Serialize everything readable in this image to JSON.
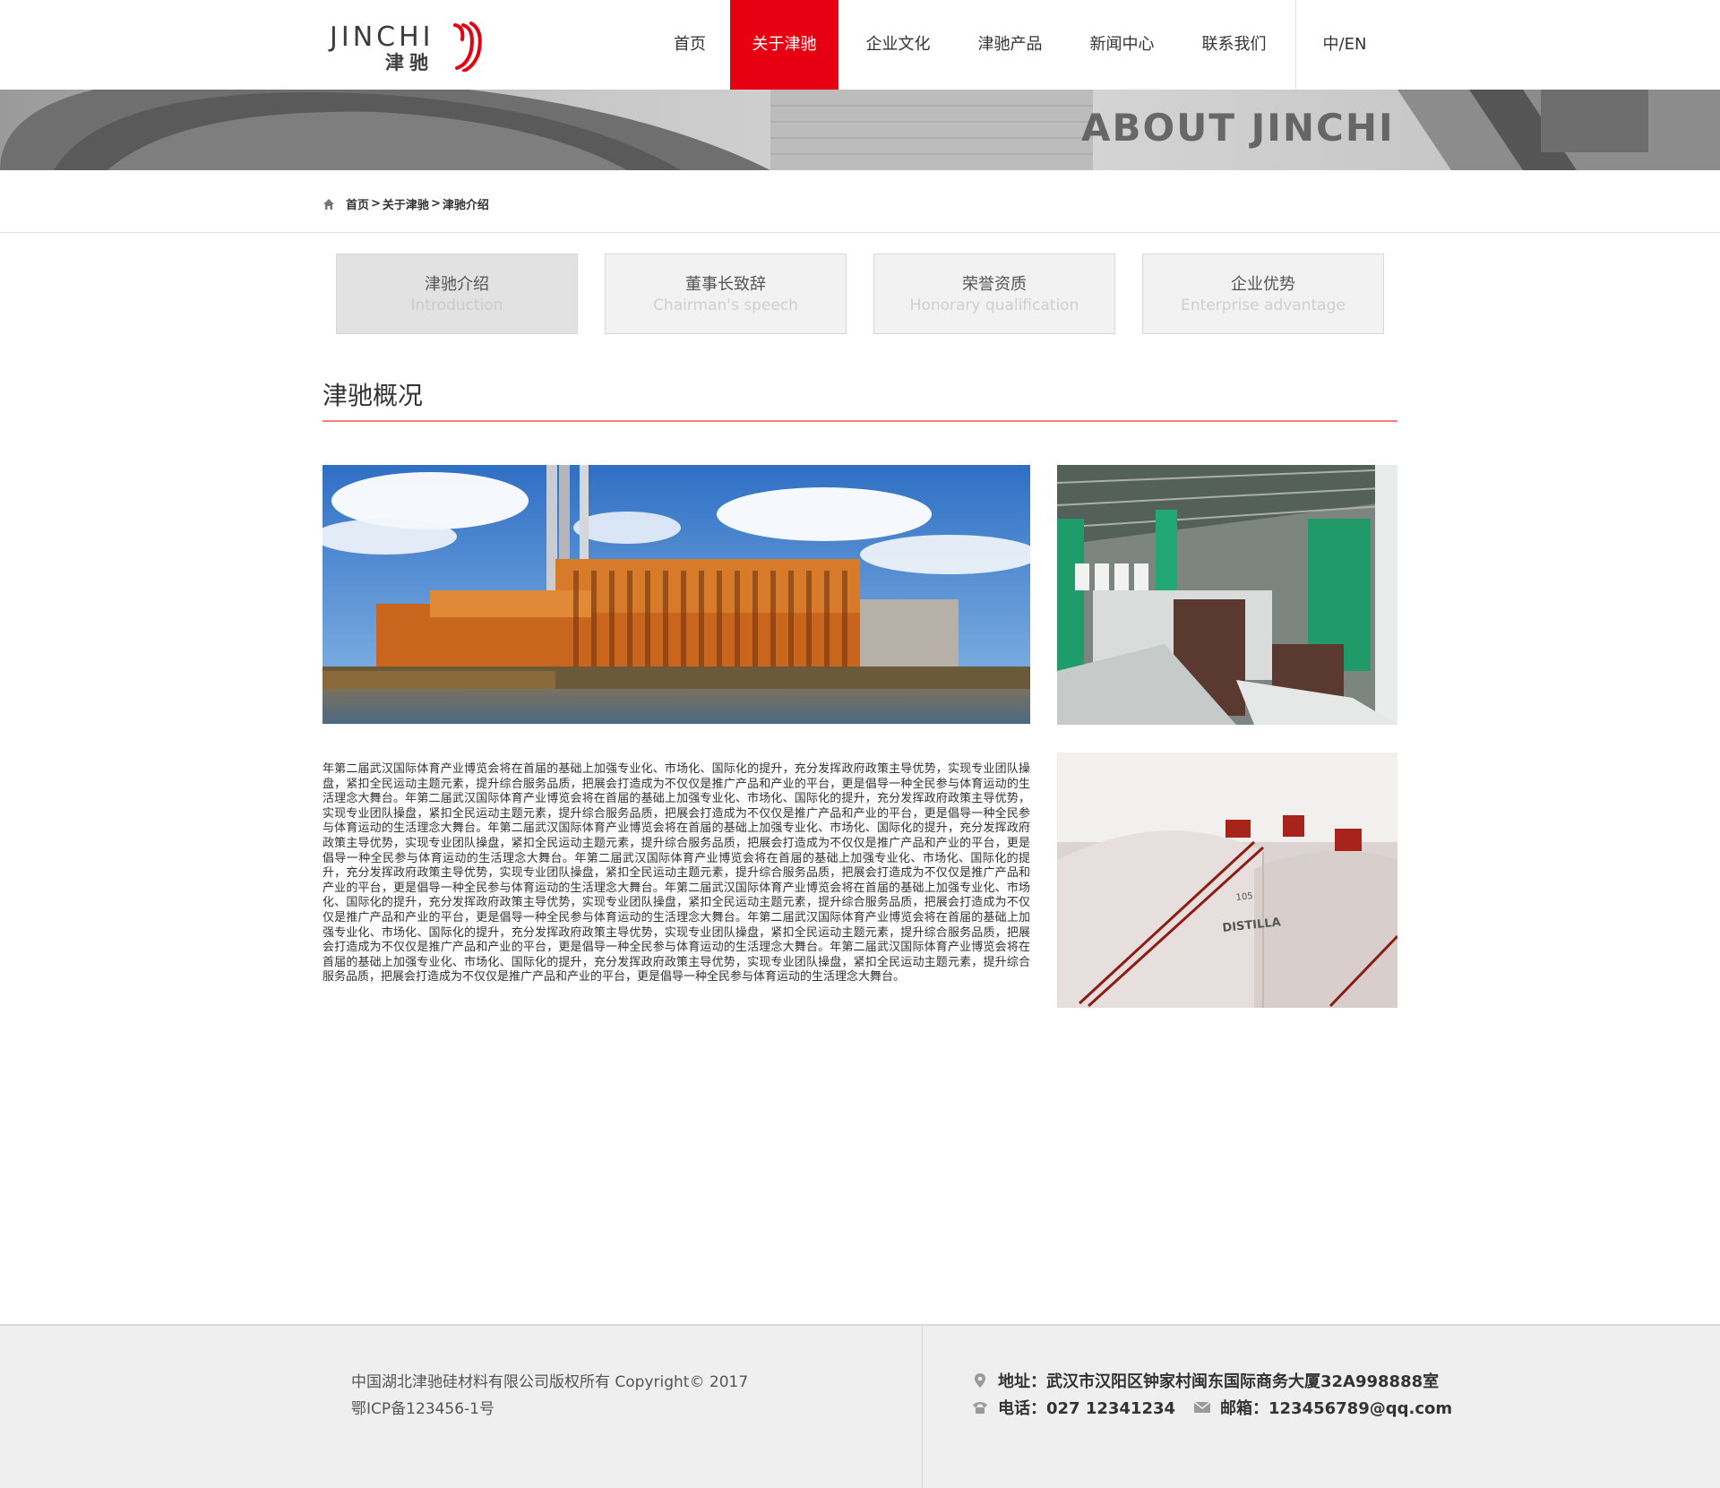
{
  "header": {
    "logo_en": "JINCHI",
    "logo_cn": "津驰",
    "nav": [
      {
        "label": "首页"
      },
      {
        "label": "关于津驰"
      },
      {
        "label": "企业文化"
      },
      {
        "label": "津驰产品"
      },
      {
        "label": "新闻中心"
      },
      {
        "label": "联系我们"
      }
    ],
    "active_nav": "关于津驰",
    "lang": "中/EN"
  },
  "banner": {
    "title": "ABOUT JINCHI"
  },
  "breadcrumb": {
    "items": [
      "首页",
      "关于津驰",
      "津驰介绍"
    ],
    "separator": ">"
  },
  "tabs": [
    {
      "cn": "津驰介绍",
      "en": "Introduction",
      "active": true
    },
    {
      "cn": "董事长致辞",
      "en": "Chairman's speech",
      "active": false
    },
    {
      "cn": "荣誉资质",
      "en": "Honorary qualification",
      "active": false
    },
    {
      "cn": "企业优势",
      "en": "Enterprise advantage",
      "active": false
    }
  ],
  "section": {
    "title": "津驰概况",
    "body": "年第二届武汉国际体育产业博览会将在首届的基础上加强专业化、市场化、国际化的提升，充分发挥政府政策主导优势，实现专业团队操盘，紧扣全民运动主题元素，提升综合服务品质，把展会打造成为不仅仅是推广产品和产业的平台，更是倡导一种全民参与体育运动的生活理念大舞台。年第二届武汉国际体育产业博览会将在首届的基础上加强专业化、市场化、国际化的提升，充分发挥政府政策主导优势，实现专业团队操盘，紧扣全民运动主题元素，提升综合服务品质，把展会打造成为不仅仅是推广产品和产业的平台，更是倡导一种全民参与体育运动的生活理念大舞台。年第二届武汉国际体育产业博览会将在首届的基础上加强专业化、市场化、国际化的提升，充分发挥政府政策主导优势，实现专业团队操盘，紧扣全民运动主题元素，提升综合服务品质，把展会打造成为不仅仅是推广产品和产业的平台，更是倡导一种全民参与体育运动的生活理念大舞台。年第二届武汉国际体育产业博览会将在首届的基础上加强专业化、市场化、国际化的提升，充分发挥政府政策主导优势，实现专业团队操盘，紧扣全民运动主题元素，提升综合服务品质，把展会打造成为不仅仅是推广产品和产业的平台，更是倡导一种全民参与体育运动的生活理念大舞台。年第二届武汉国际体育产业博览会将在首届的基础上加强专业化、市场化、国际化的提升，充分发挥政府政策主导优势，实现专业团队操盘，紧扣全民运动主题元素，提升综合服务品质，把展会打造成为不仅仅是推广产品和产业的平台，更是倡导一种全民参与体育运动的生活理念大舞台。年第二届武汉国际体育产业博览会将在首届的基础上加强专业化、市场化、国际化的提升，充分发挥政府政策主导优势，实现专业团队操盘，紧扣全民运动主题元素，提升综合服务品质，把展会打造成为不仅仅是推广产品和产业的平台，更是倡导一种全民参与体育运动的生活理念大舞台。年第二届武汉国际体育产业博览会将在首届的基础上加强专业化、市场化、国际化的提升，充分发挥政府政策主导优势，实现专业团队操盘，紧扣全民运动主题元素，提升综合服务品质，把展会打造成为不仅仅是推广产品和产业的平台，更是倡导一种全民参与体育运动的生活理念大舞台。",
    "tank_label_number": "105",
    "tank_label_text": "DISTILLA"
  },
  "footer": {
    "copyright": "中国湖北津驰硅材料有限公司版权所有 Copyright© 2017",
    "icp": "鄂ICP备123456-1号",
    "address": "地址：武汉市汉阳区钟家村闽东国际商务大厦32A998888室",
    "phone": "电话：027 12341234",
    "email": "邮箱：123456789@qq.com"
  },
  "colors": {
    "accent": "#e60012",
    "section_line": "#f2827a",
    "footer_bg": "#efefef"
  }
}
